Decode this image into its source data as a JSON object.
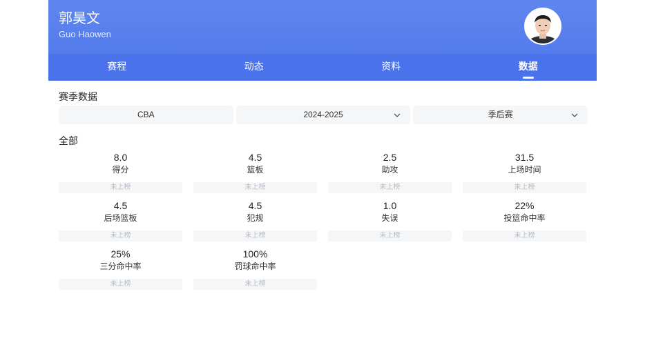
{
  "player": {
    "name_cn": "郭昊文",
    "name_en": "Guo Haowen"
  },
  "tabs": [
    {
      "label": "赛程",
      "active": false
    },
    {
      "label": "动态",
      "active": false
    },
    {
      "label": "资料",
      "active": false
    },
    {
      "label": "数据",
      "active": true
    }
  ],
  "section_title": "赛季数据",
  "filters": {
    "league": "CBA",
    "season": "2024-2025",
    "type": "季后赛"
  },
  "all_label": "全部",
  "stats": [
    {
      "value": "8.0",
      "label": "得分",
      "rank": "未上榜"
    },
    {
      "value": "4.5",
      "label": "篮板",
      "rank": "未上榜"
    },
    {
      "value": "2.5",
      "label": "助攻",
      "rank": "未上榜"
    },
    {
      "value": "31.5",
      "label": "上场时间",
      "rank": "未上榜"
    },
    {
      "value": "4.5",
      "label": "后场篮板",
      "rank": "未上榜"
    },
    {
      "value": "4.5",
      "label": "犯规",
      "rank": "未上榜"
    },
    {
      "value": "1.0",
      "label": "失误",
      "rank": "未上榜"
    },
    {
      "value": "22%",
      "label": "投篮命中率",
      "rank": "未上榜"
    },
    {
      "value": "25%",
      "label": "三分命中率",
      "rank": "未上榜"
    },
    {
      "value": "100%",
      "label": "罚球命中率",
      "rank": "未上榜"
    }
  ],
  "colors": {
    "header": "#5f86ee",
    "tabs": "#4a72ea",
    "chip_bg": "#f5f6f8"
  }
}
